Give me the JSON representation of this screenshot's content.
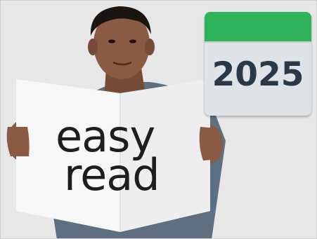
{
  "book": {
    "line1": "easy",
    "line2": "read"
  },
  "calendar": {
    "year": "2025",
    "header_color": "#2fb35a"
  },
  "subject": "man-holding-easy-read-sign"
}
